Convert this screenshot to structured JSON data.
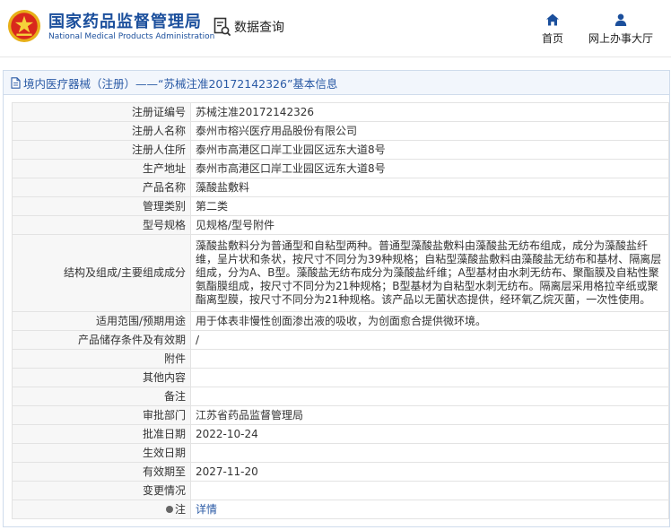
{
  "header": {
    "brand_cn": "国家药品监督管理局",
    "brand_en": "National Medical Products Administration",
    "query_label": "数据查询",
    "nav": {
      "home": "首页",
      "hall": "网上办事大厅"
    }
  },
  "section": {
    "title": "境内医疗器械（注册）——“苏械注准20172142326”基本信息"
  },
  "rows": [
    {
      "label": "注册证编号",
      "value": "苏械注准20172142326"
    },
    {
      "label": "注册人名称",
      "value": "泰州市榕兴医疗用品股份有限公司"
    },
    {
      "label": "注册人住所",
      "value": "泰州市高港区口岸工业园区远东大道8号"
    },
    {
      "label": "生产地址",
      "value": "泰州市高港区口岸工业园区远东大道8号"
    },
    {
      "label": "产品名称",
      "value": "藻酸盐敷料"
    },
    {
      "label": "管理类别",
      "value": "第二类"
    },
    {
      "label": "型号规格",
      "value": "见规格/型号附件"
    },
    {
      "label": "结构及组成/主要组成成分",
      "value": "藻酸盐敷料分为普通型和自粘型两种。普通型藻酸盐敷料由藻酸盐无纺布组成，成分为藻酸盐纤维，呈片状和条状，按尺寸不同分为39种规格；自粘型藻酸盐敷料由藻酸盐无纺布和基材、隔离层组成，分为A、B型。藻酸盐无纺布成分为藻酸盐纤维；A型基材由水刺无纺布、聚酯膜及自粘性聚氨酯膜组成，按尺寸不同分为21种规格；B型基材为自粘型水刺无纺布。隔离层采用格拉辛纸或聚酯离型膜，按尺寸不同分为21种规格。该产品以无菌状态提供，经环氧乙烷灭菌，一次性使用。"
    },
    {
      "label": "适用范围/预期用途",
      "value": "用于体表非慢性创面渗出液的吸收，为创面愈合提供微环境。"
    },
    {
      "label": "产品储存条件及有效期",
      "value": "/"
    },
    {
      "label": "附件",
      "value": ""
    },
    {
      "label": "其他内容",
      "value": ""
    },
    {
      "label": "备注",
      "value": ""
    },
    {
      "label": "审批部门",
      "value": "江苏省药品监督管理局"
    },
    {
      "label": "批准日期",
      "value": "2022-10-24"
    },
    {
      "label": "生效日期",
      "value": ""
    },
    {
      "label": "有效期至",
      "value": "2027-11-20"
    },
    {
      "label": "变更情况",
      "value": ""
    },
    {
      "label": "注",
      "value": "详情"
    }
  ],
  "colors": {
    "brand_blue": "#1b4f9c",
    "link_blue": "#2a5aa5",
    "logo_red": "#d9281c",
    "logo_gold": "#e8b019"
  }
}
